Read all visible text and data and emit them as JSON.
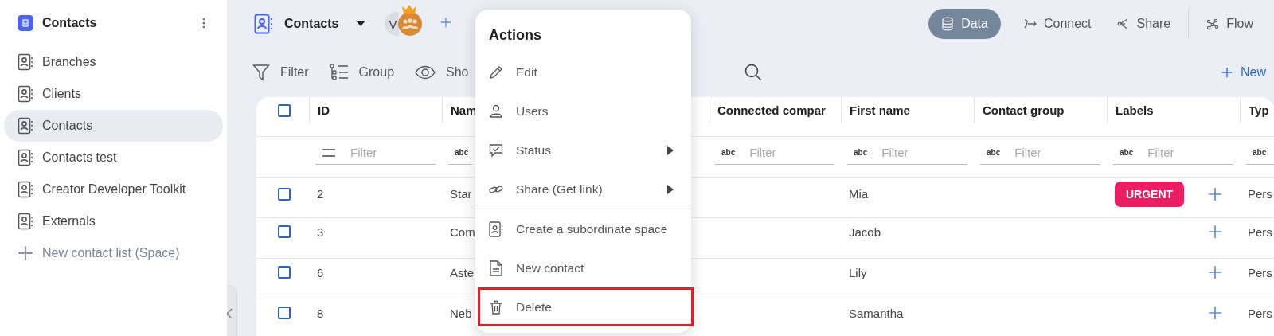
{
  "sidebar": {
    "title": "Contacts",
    "items": [
      {
        "label": "Branches",
        "kind": "space",
        "selected": false
      },
      {
        "label": "Clients",
        "kind": "space",
        "selected": false
      },
      {
        "label": "Contacts",
        "kind": "space",
        "selected": true
      },
      {
        "label": "Contacts test",
        "kind": "space",
        "selected": false
      },
      {
        "label": "Creator Developer Toolkit",
        "kind": "space",
        "selected": false
      },
      {
        "label": "Externals",
        "kind": "space",
        "selected": false
      },
      {
        "label": "New contact list (Space)",
        "kind": "add",
        "selected": false
      }
    ]
  },
  "header": {
    "title": "Contacts",
    "avatar_initial": "V",
    "views": [
      {
        "label": "Data",
        "selected": true,
        "separator_before": false
      },
      {
        "label": "Connect",
        "selected": false,
        "separator_before": true
      },
      {
        "label": "Share",
        "selected": false,
        "separator_before": false
      },
      {
        "label": "Flow",
        "selected": false,
        "separator_before": true
      }
    ]
  },
  "toolbar": {
    "items": [
      "Filter",
      "Group",
      "Sho"
    ],
    "new_button": "New"
  },
  "table": {
    "select_all_checked": false,
    "columns": [
      {
        "label": "ID",
        "placeholder": "Filter"
      },
      {
        "label": "Nam",
        "filter_badge": "abc"
      },
      {
        "label": "Connected compar",
        "filter_badge": "abc",
        "placeholder": "Filter"
      },
      {
        "label": "First name",
        "filter_badge": "abc",
        "placeholder": "Filter"
      },
      {
        "label": "Contact group",
        "filter_badge": "abc",
        "placeholder": "Filter"
      },
      {
        "label": "Labels",
        "filter_badge": "abc",
        "placeholder": "Filter"
      },
      {
        "label": "Typ",
        "filter_badge": "abc"
      }
    ],
    "rows": [
      {
        "checked": false,
        "id": "2",
        "name": "Star",
        "first_name": "Mia",
        "labels": [
          {
            "text": "URGENT",
            "color": "#e91e63"
          }
        ],
        "type": "Pers"
      },
      {
        "checked": false,
        "id": "3",
        "name": "Com",
        "first_name": "Jacob",
        "labels": [],
        "type": "Pers"
      },
      {
        "checked": false,
        "id": "6",
        "name": "Aste",
        "first_name": "Lily",
        "labels": [],
        "type": "Pers"
      },
      {
        "checked": false,
        "id": "8",
        "name": "Neb",
        "first_name": "Samantha",
        "labels": [],
        "type": "Pers"
      }
    ]
  },
  "menu": {
    "title": "Actions",
    "items": [
      {
        "label": "Edit",
        "has_submenu": false,
        "separator_before": false,
        "highlighted": false
      },
      {
        "label": "Users",
        "has_submenu": false,
        "separator_before": false,
        "highlighted": false
      },
      {
        "label": "Status",
        "has_submenu": true,
        "separator_before": false,
        "highlighted": false
      },
      {
        "label": "Share (Get link)",
        "has_submenu": true,
        "separator_before": false,
        "highlighted": false
      },
      {
        "label": "Create a subordinate space",
        "has_submenu": false,
        "separator_before": true,
        "highlighted": false
      },
      {
        "label": "New contact",
        "has_submenu": false,
        "separator_before": false,
        "highlighted": false
      },
      {
        "label": "Delete",
        "has_submenu": false,
        "separator_before": false,
        "highlighted": true
      }
    ]
  }
}
